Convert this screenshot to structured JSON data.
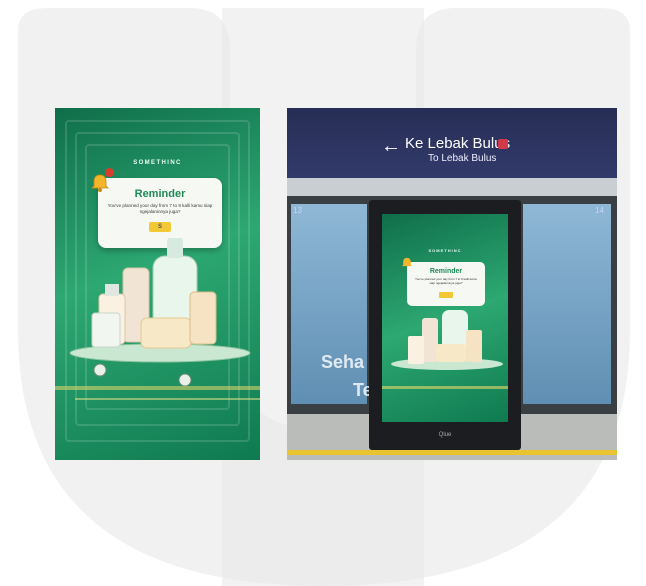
{
  "poster": {
    "brand": "SOMETHINC",
    "reminder_title": "Reminder",
    "reminder_message": "You've planned your day from 7 to 9 kalli kamu siap ngejalaninnya juga?",
    "badge": "!",
    "button_glyph": "S"
  },
  "photo": {
    "sign_main": "Ke Lebak Bulus",
    "sign_sub": "To Lebak Bulus",
    "door_left_number": "13",
    "door_right_number": "14",
    "train_text_1": "Seha",
    "train_text_2": "Te",
    "kiosk_brand": "SOMETHINC",
    "kiosk_reminder_title": "Reminder",
    "kiosk_reminder_message": "You've planned your day from 7 to 9 kalli kamu siap ngejalaninnya juga?",
    "kiosk_logo": "Qlue"
  },
  "colors": {
    "poster_green": "#2da872",
    "poster_dark": "#0f6e4a",
    "sign_navy": "#272e55",
    "accent_yellow": "#f2c935",
    "badge_red": "#d93d2b"
  }
}
